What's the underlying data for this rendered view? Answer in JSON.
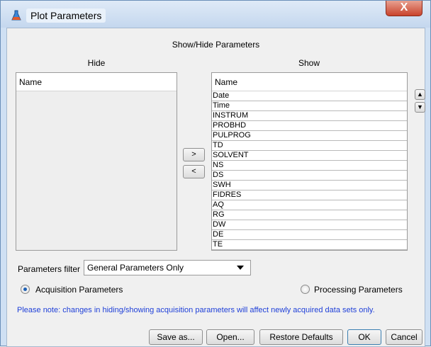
{
  "window": {
    "title": "Plot Parameters",
    "close_glyph": "X"
  },
  "panel": {
    "heading": "Show/Hide Parameters"
  },
  "hide_list": {
    "title": "Hide",
    "column_header": "Name",
    "items": []
  },
  "show_list": {
    "title": "Show",
    "column_header": "Name",
    "items": [
      "Date",
      "Time",
      "INSTRUM",
      "PROBHD",
      "PULPROG",
      "TD",
      "SOLVENT",
      "NS",
      "DS",
      "SWH",
      "FIDRES",
      "AQ",
      "RG",
      "DW",
      "DE",
      "TE"
    ]
  },
  "transfer": {
    "show_label": ">",
    "hide_label": "<"
  },
  "reorder": {
    "up_label": "▲",
    "down_label": "▼"
  },
  "filter": {
    "label": "Parameters filter",
    "selected": "General Parameters Only"
  },
  "mode": {
    "acquisition": "Acquisition Parameters",
    "processing": "Processing Parameters",
    "selected": "acquisition"
  },
  "note": "Please note: changes in hiding/showing acquisition parameters will affect newly acquired data sets only.",
  "buttons": {
    "save_as": "Save as...",
    "open": "Open...",
    "restore": "Restore Defaults",
    "ok": "OK",
    "cancel": "Cancel"
  },
  "colors": {
    "note": "#1e3fd8",
    "accent": "#1c5fb4",
    "close": "#c9432c"
  },
  "icons": {
    "app": "topspin-flask-icon",
    "dropdown": "triangle-down-icon"
  }
}
